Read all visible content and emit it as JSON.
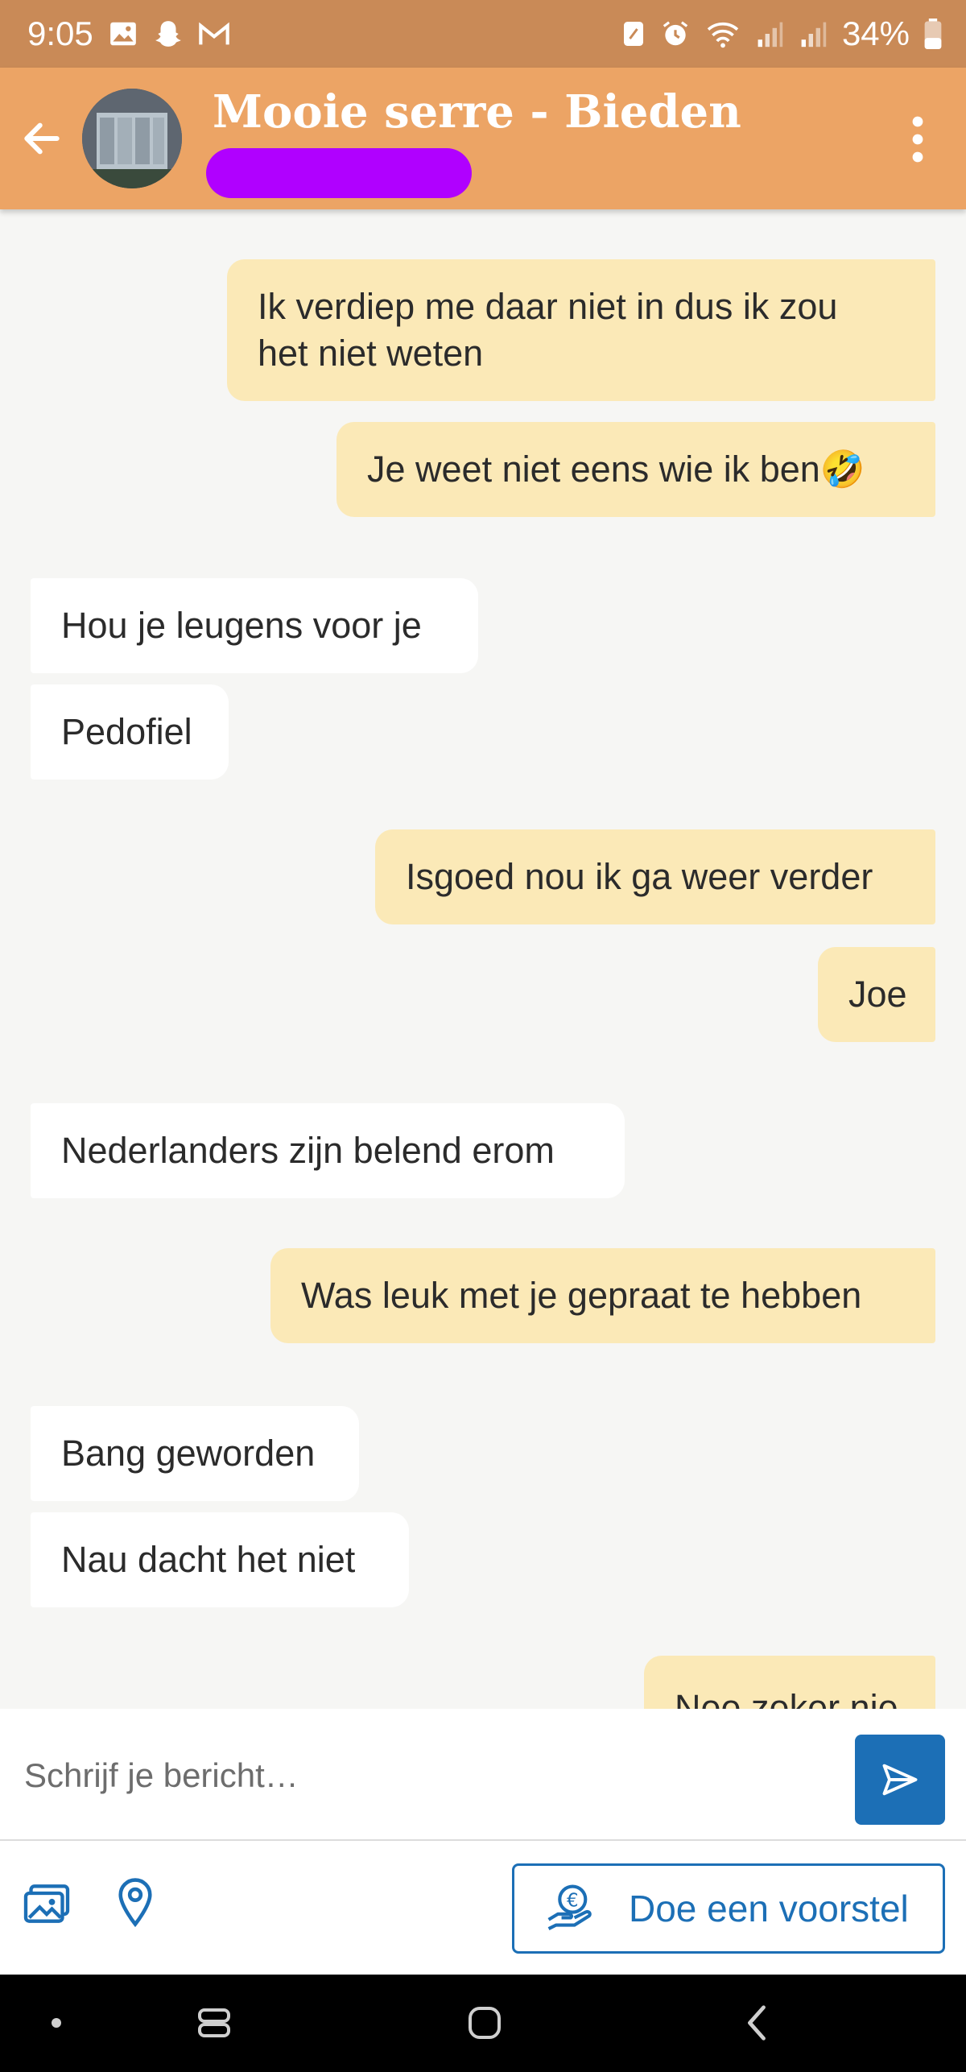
{
  "status_bar": {
    "time": "9:05",
    "battery": "34%",
    "left_icons": [
      "gallery-icon",
      "snapchat-icon",
      "gmail-icon"
    ],
    "right_icons": [
      "nfc-icon",
      "alarm-icon",
      "wifi-icon",
      "signal-icon",
      "signal-icon",
      "battery-icon"
    ],
    "color": "#c98a57"
  },
  "header": {
    "title": "Mooie serre - Bieden",
    "color": "#eca465"
  },
  "messages": [
    {
      "dir": "out",
      "lines": [
        "Ik verdiep me daar niet in dus ik zou",
        "het niet weten"
      ]
    },
    {
      "dir": "out",
      "lines": [
        "Je weet niet eens wie ik ben🤣"
      ]
    },
    {
      "dir": "in",
      "lines": [
        "Hou je leugens voor je"
      ]
    },
    {
      "dir": "in",
      "lines": [
        "Pedofiel"
      ]
    },
    {
      "dir": "out",
      "lines": [
        "Isgoed nou ik ga weer verder"
      ]
    },
    {
      "dir": "out",
      "lines": [
        "Joe"
      ]
    },
    {
      "dir": "in",
      "lines": [
        "Nederlanders zijn belend erom"
      ]
    },
    {
      "dir": "out",
      "lines": [
        "Was leuk met je gepraat te hebben"
      ]
    },
    {
      "dir": "in",
      "lines": [
        "Bang geworden"
      ]
    },
    {
      "dir": "in",
      "lines": [
        "Nau dacht het niet"
      ]
    },
    {
      "dir": "out",
      "lines": [
        "Nee zeker nie"
      ]
    }
  ],
  "composer": {
    "placeholder": "Schrijf je bericht…"
  },
  "toolbar": {
    "offer_label": "Doe een voorstel",
    "accent": "#1c6fb6"
  },
  "colors": {
    "outgoing": "#fbe9b7",
    "incoming": "#ffffff",
    "background": "#f6f6f4"
  }
}
